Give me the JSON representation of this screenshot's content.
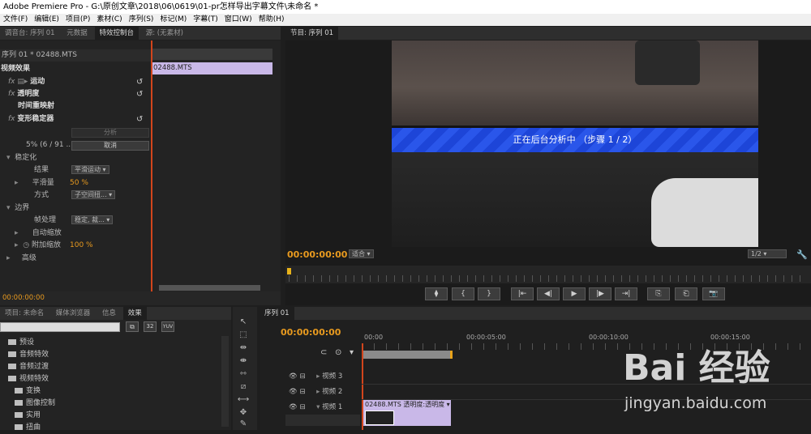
{
  "window": {
    "title": "Adobe Premiere Pro - G:\\原创文章\\2018\\06\\0619\\01-pr怎样导出字幕文件\\未命名 *"
  },
  "menu": [
    "文件(F)",
    "编辑(E)",
    "项目(P)",
    "素材(C)",
    "序列(S)",
    "标记(M)",
    "字幕(T)",
    "窗口(W)",
    "帮助(H)"
  ],
  "left_tabs": [
    "调音台: 序列 01",
    "元数据",
    "特效控制台",
    "源: (无素材)"
  ],
  "effect_controls": {
    "header": "序列 01 * 02488.MTS",
    "section": "视频效果",
    "clip_name": "02488.MTS",
    "effects": [
      "运动",
      "透明度",
      "时间重映射",
      "变形稳定器"
    ],
    "analyze_label": "分析",
    "progress_text": "5% (6 / 91 ...",
    "cancel_label": "取消",
    "stabilize_label": "稳定化",
    "result_label": "结果",
    "result_value": "平滑运动",
    "smooth_label": "平滑量",
    "smooth_value": "50 %",
    "method_label": "方式",
    "method_value": "子空间扭...",
    "border_label": "边界",
    "frame_label": "帧处理",
    "frame_value": "稳定, 裁...",
    "autoscale_label": "自动缩放",
    "addscale_label": "附加缩放",
    "addscale_value": "100 %",
    "advanced_label": "高级",
    "timecode": "00:00:00:00"
  },
  "program": {
    "tab": "节目: 序列 01",
    "banner": "正在后台分析中 （步骤 1 / 2）",
    "timecode": "00:00:00:00",
    "fit": "适合",
    "resolution": "1/2",
    "transport": [
      "⧫",
      "{",
      "}",
      "|⇤",
      "◀|",
      "▶",
      "|▶",
      "⇥|",
      "⎘",
      "⎗",
      "📷"
    ]
  },
  "project_tabs": [
    "项目: 未命名",
    "媒体浏览器",
    "信息",
    "效果"
  ],
  "effects_tree": [
    "预设",
    "音频特效",
    "音频过渡",
    "视频特效",
    "变换",
    "图像控制",
    "实用",
    "扭曲"
  ],
  "effects_icons": [
    "32",
    "YUV"
  ],
  "timeline": {
    "tab": "序列 01",
    "timecode": "00:00:00:00",
    "ruler": [
      "00:00",
      "00:00:05:00",
      "00:00:10:00",
      "00:00:15:00"
    ],
    "tracks": [
      "视频 3",
      "视频 2",
      "视频 1"
    ],
    "clip_label": "02488.MTS  透明度:透明度 ▾"
  },
  "watermark": {
    "logo": "Bai 经验",
    "url": "jingyan.baidu.com"
  }
}
